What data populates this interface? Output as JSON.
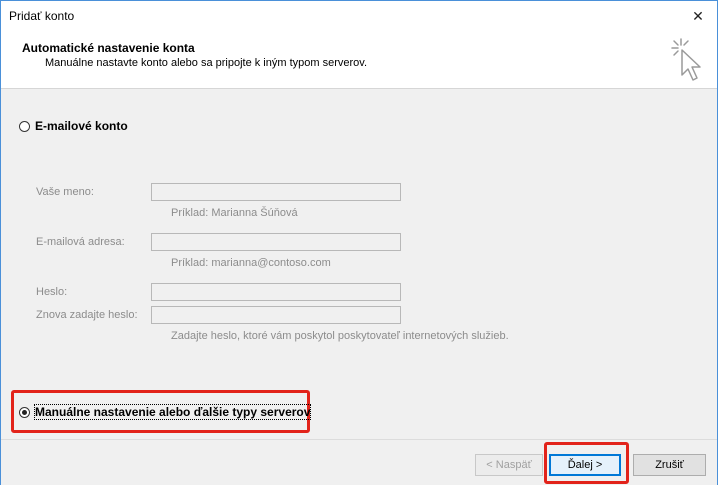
{
  "window": {
    "title": "Pridať konto",
    "close_label": "✕"
  },
  "header": {
    "title": "Automatické nastavenie konta",
    "subtitle": "Manuálne nastavte konto alebo sa pripojte k iným typom serverov."
  },
  "email_option": {
    "label": "E-mailové konto",
    "selected": false
  },
  "fields": {
    "name_label": "Vaše meno:",
    "name_value": "",
    "name_hint": "Príklad: Marianna Šúňová",
    "email_label": "E-mailová adresa:",
    "email_value": "",
    "email_hint": "Príklad: marianna@contoso.com",
    "password_label": "Heslo:",
    "password_value": "",
    "retype_label": "Znova zadajte heslo:",
    "retype_value": "",
    "password_hint": "Zadajte heslo, ktoré vám poskytol poskytovateľ internetových služieb."
  },
  "manual_option": {
    "label": "Manuálne nastavenie alebo ďalšie typy serverov",
    "selected": true
  },
  "buttons": {
    "back_label": "< Naspäť",
    "next_label": "Ďalej >",
    "cancel_label": "Zrušiť"
  },
  "colors": {
    "highlight": "#e2231a",
    "accent": "#0078d7"
  }
}
